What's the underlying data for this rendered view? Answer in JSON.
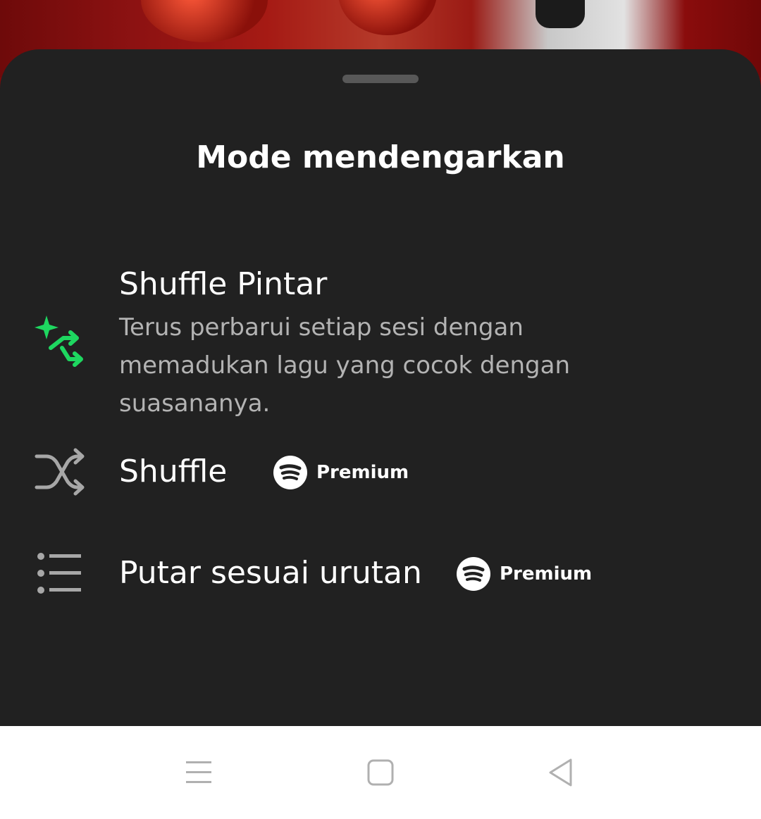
{
  "sheet": {
    "title": "Mode mendengarkan",
    "options": [
      {
        "icon": "smart-shuffle-icon",
        "label": "Shuffle Pintar",
        "description": "Terus perbarui setiap sesi dengan memadukan lagu yang cocok dengan suasananya.",
        "badge": ""
      },
      {
        "icon": "shuffle-icon",
        "label": "Shuffle",
        "badge": "Premium"
      },
      {
        "icon": "list-icon",
        "label": "Putar sesuai urutan",
        "badge": "Premium"
      }
    ]
  },
  "colors": {
    "sheet_background": "#212121",
    "accent_green": "#1ed760",
    "text_primary": "#ffffff",
    "text_secondary": "#b3b3b3"
  },
  "navbar": {
    "buttons": [
      "menu-icon",
      "home-square-icon",
      "back-triangle-icon"
    ]
  }
}
